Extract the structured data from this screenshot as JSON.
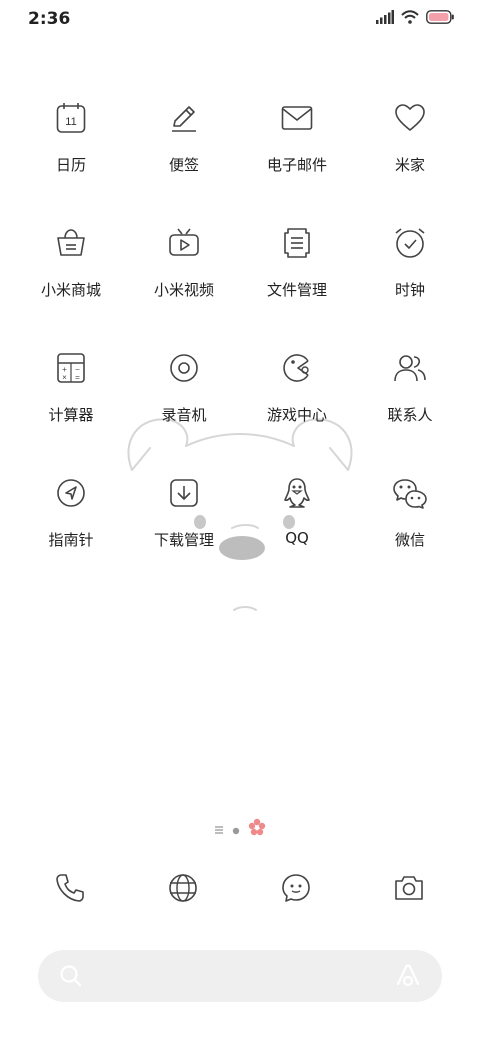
{
  "status": {
    "time": "2:36"
  },
  "apps": [
    {
      "label": "日历",
      "icon": "calendar-icon",
      "glyph": "11"
    },
    {
      "label": "便签",
      "icon": "pencil-icon"
    },
    {
      "label": "电子邮件",
      "icon": "mail-icon"
    },
    {
      "label": "米家",
      "icon": "heart-icon"
    },
    {
      "label": "小米商城",
      "icon": "shopping-basket-icon"
    },
    {
      "label": "小米视频",
      "icon": "tv-play-icon"
    },
    {
      "label": "文件管理",
      "icon": "document-icon"
    },
    {
      "label": "时钟",
      "icon": "alarm-clock-icon"
    },
    {
      "label": "计算器",
      "icon": "calculator-icon"
    },
    {
      "label": "录音机",
      "icon": "record-icon"
    },
    {
      "label": "游戏中心",
      "icon": "game-pacman-icon"
    },
    {
      "label": "联系人",
      "icon": "contacts-icon"
    },
    {
      "label": "指南针",
      "icon": "compass-icon"
    },
    {
      "label": "下载管理",
      "icon": "download-icon"
    },
    {
      "label": "QQ",
      "icon": "penguin-icon"
    },
    {
      "label": "微信",
      "icon": "wechat-icon"
    }
  ],
  "page_indicator": {
    "pages": 3,
    "active": 2,
    "active_color": "#f08a8a"
  },
  "dock": [
    {
      "icon": "phone-icon"
    },
    {
      "icon": "globe-icon"
    },
    {
      "icon": "message-bubble-icon"
    },
    {
      "icon": "camera-icon"
    }
  ],
  "search": {
    "icons": [
      "search-icon",
      "assistant-icon"
    ]
  }
}
